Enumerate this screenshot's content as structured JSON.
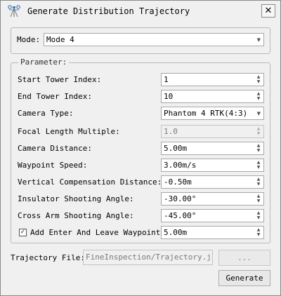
{
  "window": {
    "title": "Generate Distribution Trajectory",
    "close_label": "✕"
  },
  "mode": {
    "label": "Mode:",
    "value": "Mode 4"
  },
  "parameter": {
    "legend": "Parameter:",
    "start_tower_index": {
      "label": "Start Tower Index:",
      "value": "1"
    },
    "end_tower_index": {
      "label": "End Tower Index:",
      "value": "10"
    },
    "camera_type": {
      "label": "Camera Type:",
      "value": "Phantom 4 RTK(4:3)"
    },
    "focal_length_multiple": {
      "label": "Focal Length Multiple:",
      "value": "1.0"
    },
    "camera_distance": {
      "label": "Camera Distance:",
      "value": "5.00m"
    },
    "waypoint_speed": {
      "label": "Waypoint Speed:",
      "value": "3.00m/s"
    },
    "vertical_compensation_distance": {
      "label": "Vertical Compensation Distance:",
      "value": "-0.50m"
    },
    "insulator_shooting_angle": {
      "label": "Insulator Shooting Angle:",
      "value": "-30.00°"
    },
    "cross_arm_shooting_angle": {
      "label": "Cross Arm Shooting Angle:",
      "value": "-45.00°"
    },
    "enter_leave_waypoints": {
      "label": "Add Enter And Leave Waypoints",
      "checked": true,
      "check_mark": "✓",
      "value": "5.00m"
    }
  },
  "trajectory_file": {
    "label": "Trajectory File:",
    "value": "FineInspection/Trajectory.json",
    "browse_label": "..."
  },
  "generate_label": "Generate",
  "icons": {
    "app": "drone-tower-icon",
    "spin_up": "▲",
    "spin_down": "▼",
    "combo": "▼"
  }
}
